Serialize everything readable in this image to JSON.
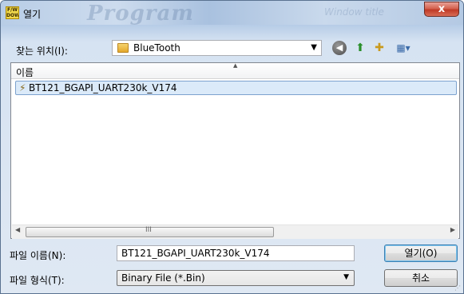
{
  "window": {
    "title": "열기",
    "app_icon_text": "F/W DOWN",
    "watermark": "Program",
    "watermark_secondary": "Window title",
    "close_glyph": "x"
  },
  "lookin": {
    "label": "찾는 위치(I):",
    "folder": "BlueTooth"
  },
  "toolbar": {
    "back_glyph": "◀",
    "up_glyph": "⬆",
    "new_folder_glyph": "✚",
    "view_glyph": "▦▾"
  },
  "list": {
    "column_name": "이름",
    "files": [
      {
        "name": "BT121_BGAPI_UART230k_V174",
        "selected": true
      }
    ]
  },
  "scrollbar": {
    "left_glyph": "◀",
    "right_glyph": "▶",
    "grip_glyph": "III"
  },
  "filename": {
    "label": "파일 이름(N):",
    "value": "BT121_BGAPI_UART230k_V174"
  },
  "filetype": {
    "label": "파일 형식(T):",
    "value": "Binary File (*.Bin)"
  },
  "buttons": {
    "open": "열기(O)",
    "cancel": "취소"
  },
  "colors": {
    "selection": "#dbeaf9",
    "selection_border": "#7da2ce",
    "close_button": "#c9432e"
  },
  "icons": [
    "folder-icon",
    "back-icon",
    "up-folder-icon",
    "new-folder-icon",
    "view-menu-icon",
    "firmware-file-icon"
  ]
}
